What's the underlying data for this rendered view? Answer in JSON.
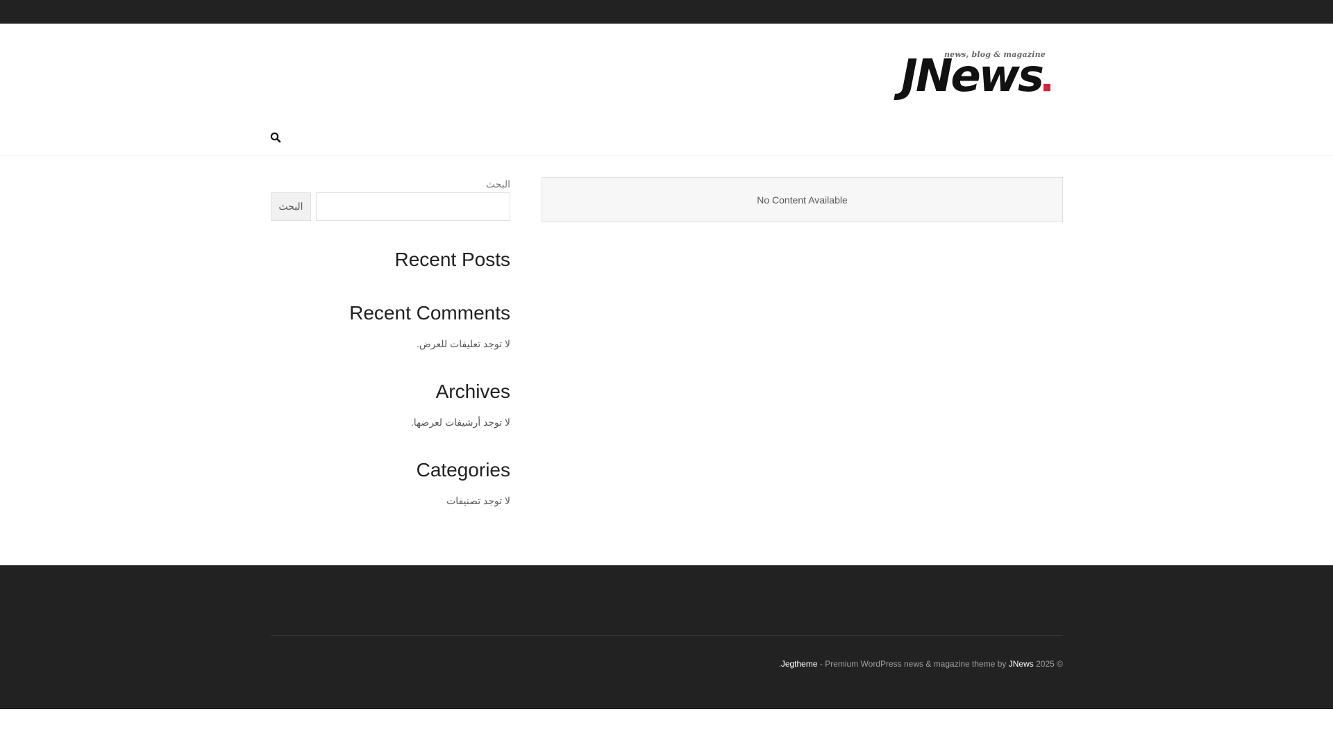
{
  "logo": {
    "tagline": "news, blog & magazine",
    "wordmark": "JNews"
  },
  "header": {
    "search_icon": "search-icon"
  },
  "main": {
    "empty_message": "No Content Available"
  },
  "sidebar": {
    "search_label": "البحث",
    "search_placeholder": "",
    "search_button": "البحث",
    "recent_posts_title": "Recent Posts",
    "recent_comments_title": "Recent Comments",
    "recent_comments_empty": "لا توجد تعليقات للعرض.",
    "archives_title": "Archives",
    "archives_empty": "لا توجد أرشيفات لعرضها.",
    "categories_title": "Categories",
    "categories_empty": "لا توجد تصنيفات"
  },
  "footer": {
    "copyright_prefix": "© 2025",
    "site_link": "JNews",
    "middle_text": "- Premium WordPress news & magazine theme by",
    "author_link": "Jegtheme"
  },
  "colors": {
    "dark_bar": "#222222",
    "accent_red": "#e01e37"
  }
}
